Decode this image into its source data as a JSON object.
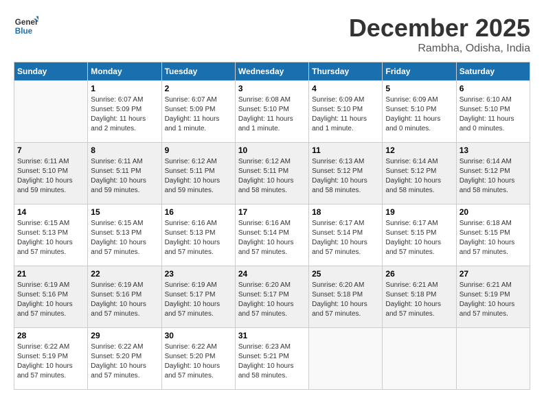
{
  "header": {
    "logo_line1": "General",
    "logo_line2": "Blue",
    "month_year": "December 2025",
    "location": "Rambha, Odisha, India"
  },
  "days_of_week": [
    "Sunday",
    "Monday",
    "Tuesday",
    "Wednesday",
    "Thursday",
    "Friday",
    "Saturday"
  ],
  "weeks": [
    [
      {
        "day": "",
        "info": ""
      },
      {
        "day": "1",
        "info": "Sunrise: 6:07 AM\nSunset: 5:09 PM\nDaylight: 11 hours\nand 2 minutes."
      },
      {
        "day": "2",
        "info": "Sunrise: 6:07 AM\nSunset: 5:09 PM\nDaylight: 11 hours\nand 1 minute."
      },
      {
        "day": "3",
        "info": "Sunrise: 6:08 AM\nSunset: 5:10 PM\nDaylight: 11 hours\nand 1 minute."
      },
      {
        "day": "4",
        "info": "Sunrise: 6:09 AM\nSunset: 5:10 PM\nDaylight: 11 hours\nand 1 minute."
      },
      {
        "day": "5",
        "info": "Sunrise: 6:09 AM\nSunset: 5:10 PM\nDaylight: 11 hours\nand 0 minutes."
      },
      {
        "day": "6",
        "info": "Sunrise: 6:10 AM\nSunset: 5:10 PM\nDaylight: 11 hours\nand 0 minutes."
      }
    ],
    [
      {
        "day": "7",
        "info": "Sunrise: 6:11 AM\nSunset: 5:10 PM\nDaylight: 10 hours\nand 59 minutes."
      },
      {
        "day": "8",
        "info": "Sunrise: 6:11 AM\nSunset: 5:11 PM\nDaylight: 10 hours\nand 59 minutes."
      },
      {
        "day": "9",
        "info": "Sunrise: 6:12 AM\nSunset: 5:11 PM\nDaylight: 10 hours\nand 59 minutes."
      },
      {
        "day": "10",
        "info": "Sunrise: 6:12 AM\nSunset: 5:11 PM\nDaylight: 10 hours\nand 58 minutes."
      },
      {
        "day": "11",
        "info": "Sunrise: 6:13 AM\nSunset: 5:12 PM\nDaylight: 10 hours\nand 58 minutes."
      },
      {
        "day": "12",
        "info": "Sunrise: 6:14 AM\nSunset: 5:12 PM\nDaylight: 10 hours\nand 58 minutes."
      },
      {
        "day": "13",
        "info": "Sunrise: 6:14 AM\nSunset: 5:12 PM\nDaylight: 10 hours\nand 58 minutes."
      }
    ],
    [
      {
        "day": "14",
        "info": "Sunrise: 6:15 AM\nSunset: 5:13 PM\nDaylight: 10 hours\nand 57 minutes."
      },
      {
        "day": "15",
        "info": "Sunrise: 6:15 AM\nSunset: 5:13 PM\nDaylight: 10 hours\nand 57 minutes."
      },
      {
        "day": "16",
        "info": "Sunrise: 6:16 AM\nSunset: 5:13 PM\nDaylight: 10 hours\nand 57 minutes."
      },
      {
        "day": "17",
        "info": "Sunrise: 6:16 AM\nSunset: 5:14 PM\nDaylight: 10 hours\nand 57 minutes."
      },
      {
        "day": "18",
        "info": "Sunrise: 6:17 AM\nSunset: 5:14 PM\nDaylight: 10 hours\nand 57 minutes."
      },
      {
        "day": "19",
        "info": "Sunrise: 6:17 AM\nSunset: 5:15 PM\nDaylight: 10 hours\nand 57 minutes."
      },
      {
        "day": "20",
        "info": "Sunrise: 6:18 AM\nSunset: 5:15 PM\nDaylight: 10 hours\nand 57 minutes."
      }
    ],
    [
      {
        "day": "21",
        "info": "Sunrise: 6:19 AM\nSunset: 5:16 PM\nDaylight: 10 hours\nand 57 minutes."
      },
      {
        "day": "22",
        "info": "Sunrise: 6:19 AM\nSunset: 5:16 PM\nDaylight: 10 hours\nand 57 minutes."
      },
      {
        "day": "23",
        "info": "Sunrise: 6:19 AM\nSunset: 5:17 PM\nDaylight: 10 hours\nand 57 minutes."
      },
      {
        "day": "24",
        "info": "Sunrise: 6:20 AM\nSunset: 5:17 PM\nDaylight: 10 hours\nand 57 minutes."
      },
      {
        "day": "25",
        "info": "Sunrise: 6:20 AM\nSunset: 5:18 PM\nDaylight: 10 hours\nand 57 minutes."
      },
      {
        "day": "26",
        "info": "Sunrise: 6:21 AM\nSunset: 5:18 PM\nDaylight: 10 hours\nand 57 minutes."
      },
      {
        "day": "27",
        "info": "Sunrise: 6:21 AM\nSunset: 5:19 PM\nDaylight: 10 hours\nand 57 minutes."
      }
    ],
    [
      {
        "day": "28",
        "info": "Sunrise: 6:22 AM\nSunset: 5:19 PM\nDaylight: 10 hours\nand 57 minutes."
      },
      {
        "day": "29",
        "info": "Sunrise: 6:22 AM\nSunset: 5:20 PM\nDaylight: 10 hours\nand 57 minutes."
      },
      {
        "day": "30",
        "info": "Sunrise: 6:22 AM\nSunset: 5:20 PM\nDaylight: 10 hours\nand 57 minutes."
      },
      {
        "day": "31",
        "info": "Sunrise: 6:23 AM\nSunset: 5:21 PM\nDaylight: 10 hours\nand 58 minutes."
      },
      {
        "day": "",
        "info": ""
      },
      {
        "day": "",
        "info": ""
      },
      {
        "day": "",
        "info": ""
      }
    ]
  ]
}
